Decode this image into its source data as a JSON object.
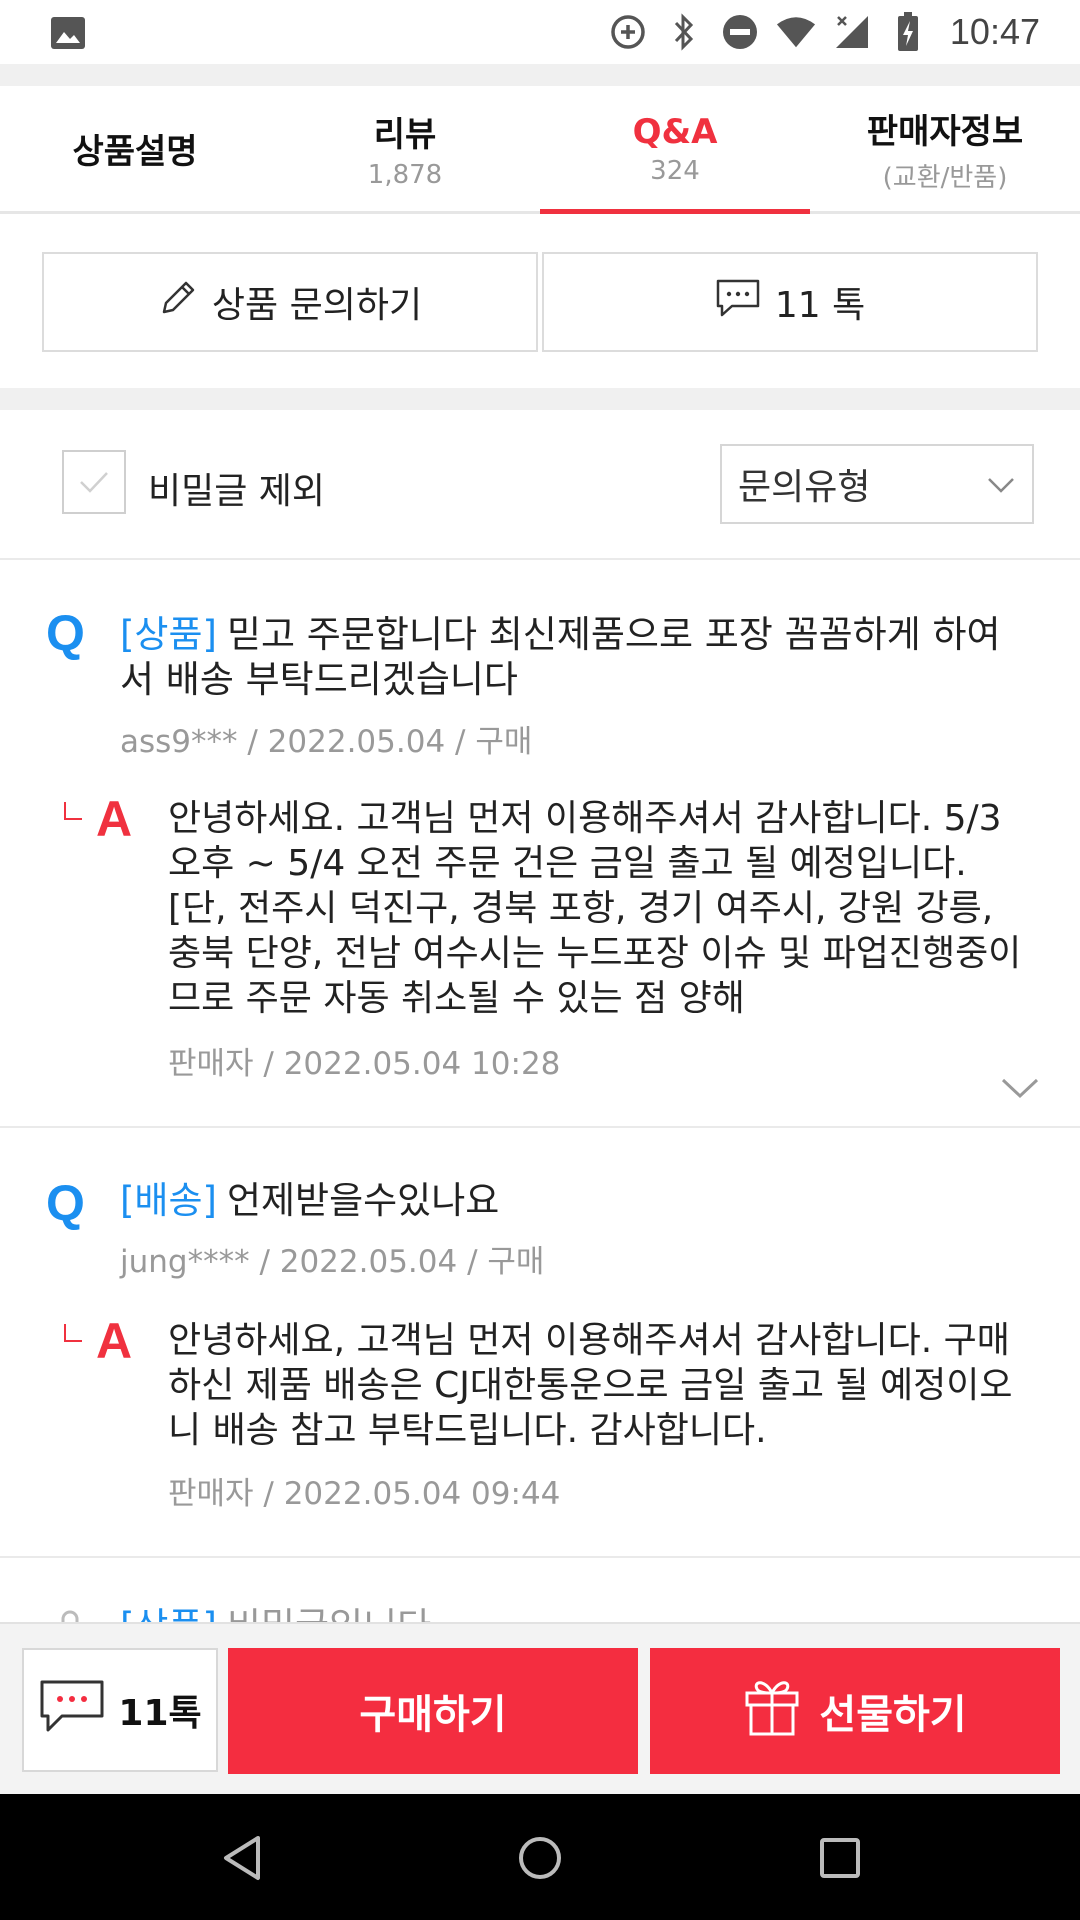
{
  "status_bar": {
    "time": "10:47",
    "icons": [
      "image-icon",
      "data-saver-icon",
      "bluetooth-icon",
      "do-not-disturb-icon",
      "wifi-icon",
      "signal-icon",
      "battery-charging-icon"
    ]
  },
  "tabs": [
    {
      "label": "상품설명",
      "sub": ""
    },
    {
      "label": "리뷰",
      "sub": "1,878"
    },
    {
      "label": "Q&A",
      "sub": "324"
    },
    {
      "label": "판매자정보",
      "sub": "(교환/반품)"
    }
  ],
  "actions": {
    "ask_label": "상품 문의하기",
    "talk_label": "11 톡"
  },
  "filter": {
    "exclude_secret_label": "비밀글 제외",
    "type_select_value": "문의유형"
  },
  "qa": [
    {
      "q_mark": "Q",
      "category": "[상품]",
      "question": "믿고  주문합니다 최신제품으로 포장 꼼꼼하게 하여서 배송 부탁드리겠습니다",
      "meta": "ass9*** / 2022.05.04 / 구매",
      "a_mark": "A",
      "answer": "안녕하세요. 고객님  먼저 이용해주셔서 감사합니다. 5/3 오후 ~ 5/4 오전 주문 건은 금일 출고 될 예정입니다.  [단, 전주시 덕진구, 경북 포항, 경기 여주시, 강원 강릉, 충북 단양, 전남 여수시는 누드포장 이슈 및 파업진행중이므로 주문 자동 취소될 수 있는 점 양해",
      "answer_meta": "판매자 / 2022.05.04 10:28"
    },
    {
      "q_mark": "Q",
      "category": "[배송]",
      "question": "언제받을수있나요",
      "meta": "jung**** / 2022.05.04 / 구매",
      "a_mark": "A",
      "answer": "안녕하세요, 고객님  먼저 이용해주셔서 감사합니다. 구매하신 제품 배송은 CJ대한통운으로 금일 출고 될 예정이오니 배송 참고 부탁드립니다.  감사합니다.",
      "answer_meta": "판매자 / 2022.05.04 09:44"
    },
    {
      "category": "[상품]",
      "question": "비밀글입니다"
    }
  ],
  "bottom_bar": {
    "talk_label": "11톡",
    "buy_label": "구매하기",
    "gift_label": "선물하기"
  },
  "colors": {
    "accent_red": "#f0313f",
    "question_blue": "#1b8ff0",
    "button_red": "#f42d40"
  }
}
